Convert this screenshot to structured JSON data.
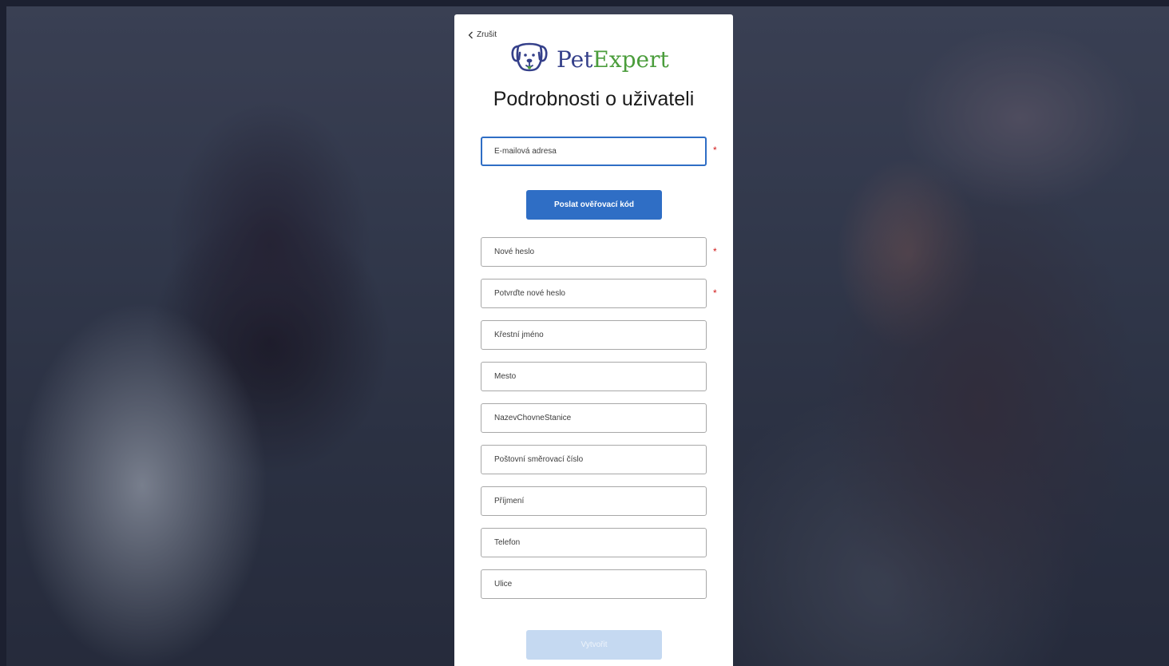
{
  "header": {
    "back_label": "Zrušit",
    "logo_pet": "Pet",
    "logo_expert": "Expert",
    "title": "Podrobnosti o uživateli"
  },
  "colors": {
    "primary_button": "#2f6ec5",
    "disabled_button": "#c5d9f1",
    "logo_pet": "#35408a",
    "logo_expert": "#4b9d3c",
    "required_marker": "#d11919"
  },
  "form": {
    "email": {
      "placeholder": "E-mailová adresa",
      "value": "",
      "required": "*"
    },
    "send_code_label": "Poslat ověřovací kód",
    "new_password": {
      "placeholder": "Nové heslo",
      "value": "",
      "required": "*"
    },
    "confirm_password": {
      "placeholder": "Potvrďte nové heslo",
      "value": "",
      "required": "*"
    },
    "first_name": {
      "placeholder": "Křestní jméno",
      "value": ""
    },
    "city": {
      "placeholder": "Mesto",
      "value": ""
    },
    "kennel_name": {
      "placeholder": "NazevChovneStanice",
      "value": ""
    },
    "postal_code": {
      "placeholder": "Poštovní směrovací číslo",
      "value": ""
    },
    "surname": {
      "placeholder": "Příjmení",
      "value": ""
    },
    "phone": {
      "placeholder": "Telefon",
      "value": ""
    },
    "street": {
      "placeholder": "Ulice",
      "value": ""
    },
    "create_label": "Vytvořit"
  }
}
